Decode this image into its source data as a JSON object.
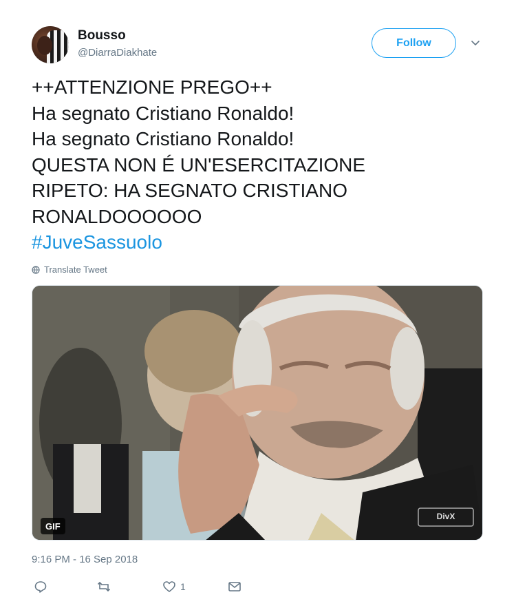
{
  "author": {
    "name": "Bousso",
    "handle": "@DiarraDiakhate"
  },
  "follow": {
    "label": "Follow"
  },
  "tweet": {
    "lines": [
      "++ATTENZIONE PREGO++",
      "Ha segnato Cristiano Ronaldo!",
      "Ha segnato Cristiano Ronaldo!",
      "QUESTA NON É UN'ESERCITAZIONE",
      "RIPETO: HA SEGNATO CRISTIANO",
      "RONALDOOOOOO"
    ],
    "hashtag": "#JuveSassuolo"
  },
  "translate": {
    "label": "Translate Tweet"
  },
  "media": {
    "gif_label": "GIF",
    "watermark": "DivX"
  },
  "timestamp": "9:16 PM - 16 Sep 2018",
  "actions": {
    "reply_icon": "reply-icon",
    "retweet_icon": "retweet-icon",
    "like_icon": "heart-icon",
    "like_count": "1",
    "message_icon": "envelope-icon"
  },
  "colors": {
    "accent": "#1da1f2",
    "hashtag": "#1b95e0",
    "muted": "#657786",
    "text": "#14171a"
  }
}
